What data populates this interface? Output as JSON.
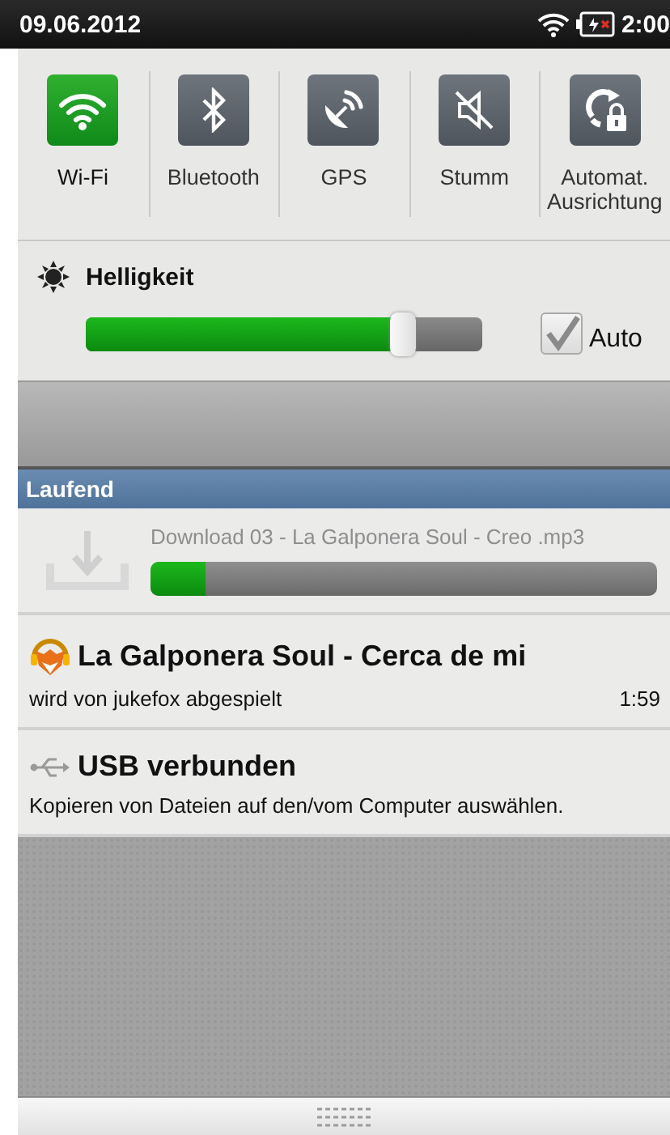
{
  "status_bar": {
    "date": "09.06.2012",
    "time": "2:00"
  },
  "toggles": [
    {
      "kind": "wifi",
      "label": "Wi-Fi",
      "on": true
    },
    {
      "kind": "bluetooth",
      "label": "Bluetooth",
      "on": false
    },
    {
      "kind": "gps",
      "label": "GPS",
      "on": false
    },
    {
      "kind": "mute",
      "label": "Stumm",
      "on": false
    },
    {
      "kind": "rotate",
      "label": "Automat. Ausrichtung",
      "on": false
    }
  ],
  "brightness": {
    "label": "Helligkeit",
    "level": 0.8,
    "auto": {
      "label": "Auto",
      "checked": true
    }
  },
  "ongoing": {
    "header": "Laufend",
    "notifications": [
      {
        "kind": "download",
        "title": "Download 03 - La Galponera Soul - Creo .mp3",
        "level": 0.11
      },
      {
        "kind": "media",
        "title": "La Galponera Soul - Cerca de mi",
        "text": "wird von jukefox abgespielt",
        "time": "1:59"
      },
      {
        "kind": "usb",
        "title": "USB verbunden",
        "text": "Kopieren von Dateien auf den/vom Computer auswählen."
      }
    ]
  }
}
